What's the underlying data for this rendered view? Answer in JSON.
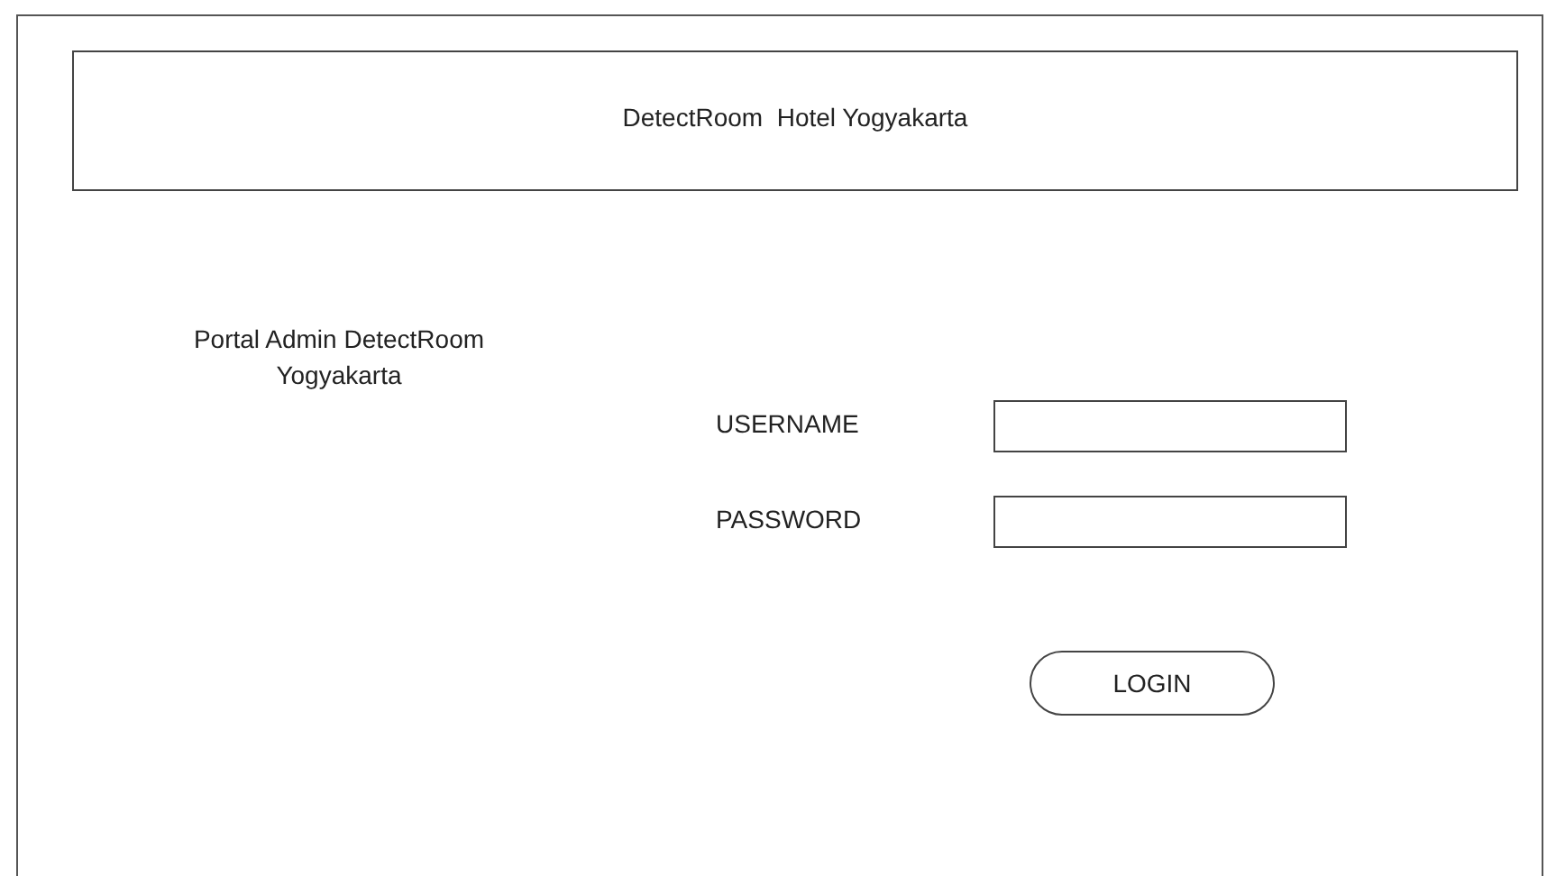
{
  "header": {
    "title": "DetectRoom  Hotel Yogyakarta"
  },
  "portal": {
    "caption": "Portal Admin DetectRoom Yogyakarta"
  },
  "form": {
    "fields": [
      {
        "label": "USERNAME"
      },
      {
        "label": "PASSWORD"
      }
    ],
    "button": "LOGIN"
  }
}
